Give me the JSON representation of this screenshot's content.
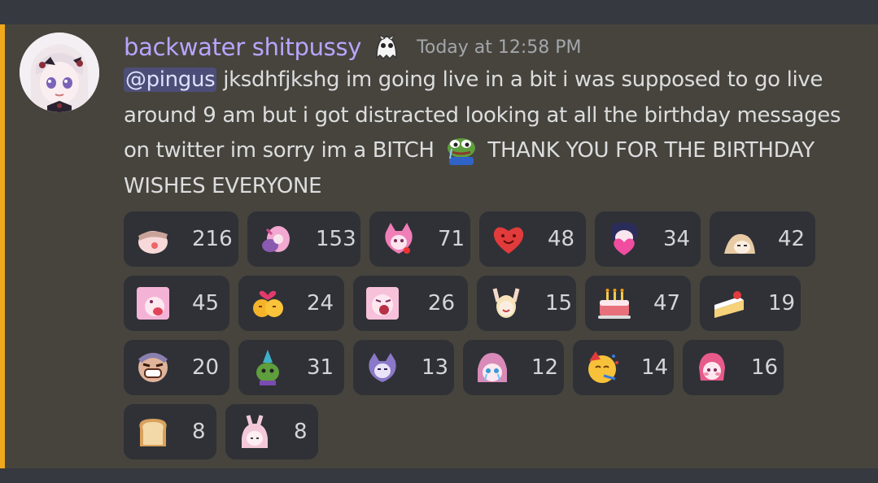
{
  "message": {
    "author": "backwater shitpussy",
    "role_icon": "ghost-icon",
    "timestamp": "Today at 12:58 PM",
    "mention": "@pingus",
    "text_part1": " jksdhfjkshg im going live in a bit i was supposed to go live around 9 am but i got distracted looking at all the birthday messages on twitter im sorry im a BITCH ",
    "inline_emoji": "pepe-cry-icon",
    "text_part2": " THANK YOU FOR THE BIRTHDAY WISHES EVERYONE",
    "accent_color": "#f0a81c",
    "username_color": "#b8a5ff"
  },
  "reactions": [
    {
      "icon": "hand-pinch-emote-icon",
      "count": "216"
    },
    {
      "icon": "anime-girl-hug-emote-icon",
      "count": "153"
    },
    {
      "icon": "pink-catgirl-emote-icon",
      "count": "71"
    },
    {
      "icon": "smiling-heart-icon",
      "count": "48"
    },
    {
      "icon": "girl-holding-heart-emote-icon",
      "count": "34"
    },
    {
      "icon": "peeking-girl-emote-icon",
      "count": "42"
    },
    {
      "icon": "pink-girl-tongue-emote-icon",
      "count": "45"
    },
    {
      "icon": "kissing-couple-hearts-icon",
      "count": "24"
    },
    {
      "icon": "pink-girl-shout-emote-icon",
      "count": "26"
    },
    {
      "icon": "cheering-girl-emote-icon",
      "count": "15"
    },
    {
      "icon": "birthday-cake-icon",
      "count": "47"
    },
    {
      "icon": "shortcake-icon",
      "count": "19"
    },
    {
      "icon": "laughing-man-emote-icon",
      "count": "20"
    },
    {
      "icon": "pepe-party-hat-icon",
      "count": "31"
    },
    {
      "icon": "purple-catgirl-emote-icon",
      "count": "13"
    },
    {
      "icon": "crying-girl-emote-icon",
      "count": "12"
    },
    {
      "icon": "partying-face-icon",
      "count": "14"
    },
    {
      "icon": "pink-girl-blush-emote-icon",
      "count": "16"
    },
    {
      "icon": "bread-icon",
      "count": "8"
    },
    {
      "icon": "bunny-girl-emote-icon",
      "count": "8"
    }
  ]
}
